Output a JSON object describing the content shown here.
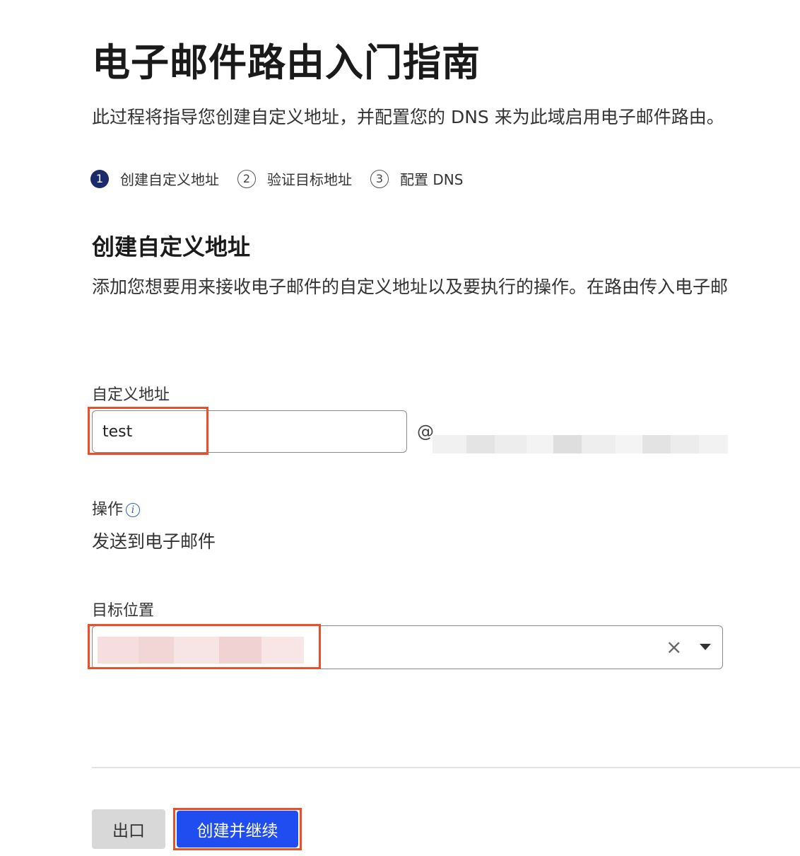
{
  "header": {
    "title": "电子邮件路由入门指南",
    "intro": "此过程将指导您创建自定义地址，并配置您的 DNS 来为此域启用电子邮件路由。"
  },
  "steps": [
    {
      "number": "1",
      "label": "创建自定义地址",
      "active": true
    },
    {
      "number": "2",
      "label": "验证目标地址",
      "active": false
    },
    {
      "number": "3",
      "label": "配置 DNS",
      "active": false
    }
  ],
  "section": {
    "title": "创建自定义地址",
    "description": "添加您想要用来接收电子邮件的自定义地址以及要执行的操作。在路由传入电子邮"
  },
  "form": {
    "custom_address": {
      "label": "自定义地址",
      "value": "test",
      "at_sign": "@"
    },
    "action": {
      "label": "操作",
      "info_icon": "info-icon",
      "value": "发送到电子邮件"
    },
    "destination": {
      "label": "目标位置",
      "clear_icon": "×"
    }
  },
  "footer": {
    "exit_label": "出口",
    "create_label": "创建并继续"
  },
  "colors": {
    "accent": "#1f4df0",
    "step_active": "#1b2a6b",
    "highlight": "#e8502b"
  }
}
